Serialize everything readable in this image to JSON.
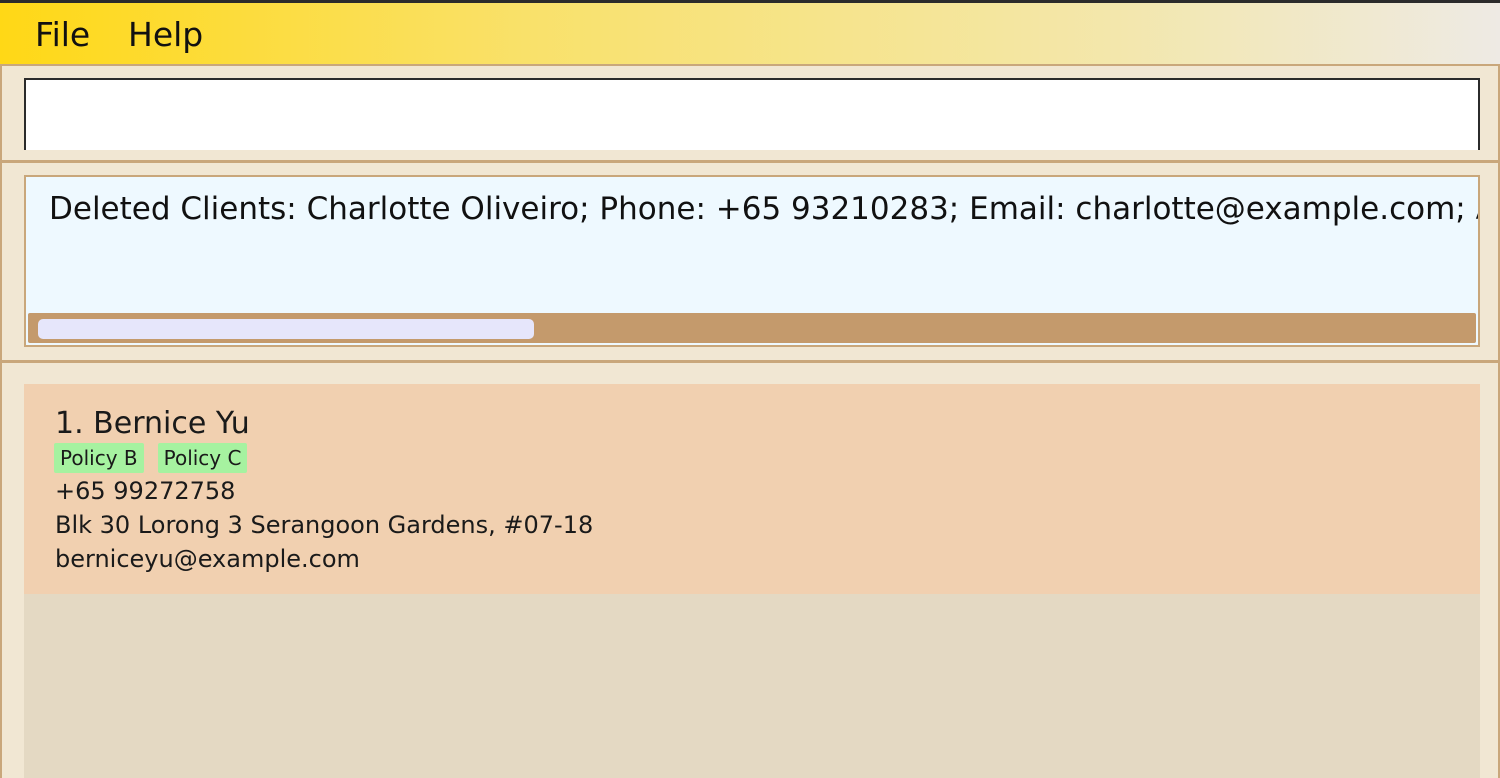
{
  "menu": {
    "file_label": "File",
    "help_label": "Help"
  },
  "command_box": {
    "value": "",
    "placeholder": ""
  },
  "result_display": {
    "text": "Deleted Clients: Charlotte Oliveiro; Phone: +65 93210283; Email: charlotte@example.com; Address"
  },
  "client_list": {
    "items": [
      {
        "index_name": "1. Bernice Yu",
        "tags": [
          "Policy B",
          "Policy C"
        ],
        "phone": "+65 99272758",
        "address": "Blk 30 Lorong 3 Serangoon Gardens, #07-18",
        "email": "berniceyu@example.com"
      }
    ]
  },
  "colors": {
    "menubar_start": "#ffd816",
    "pane_background": "#f1e7d3",
    "result_background": "#eef9ff",
    "card_background": "#f1d0b0",
    "tag_background": "#a6f2a0",
    "scrollbar_track": "#c49a6c",
    "scrollbar_thumb": "#e6e6fb"
  }
}
